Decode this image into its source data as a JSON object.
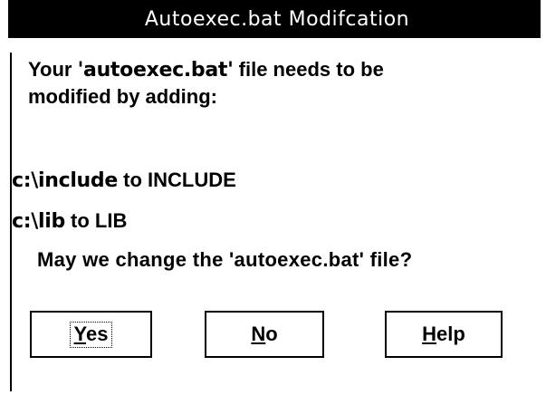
{
  "dialog": {
    "title": "Autoexec.bat Modifcation",
    "message": {
      "prefix": "Your ",
      "filename": "'autoexec.bat'",
      "suffix_line1": " file needs to be",
      "line2": "modified by adding:"
    },
    "entries": [
      {
        "path": "c:\\include",
        "text": " to INCLUDE"
      },
      {
        "path": "c:\\lib",
        "text": " to LIB"
      }
    ],
    "question": "May we change the 'autoexec.bat' file?",
    "buttons": {
      "yes": {
        "mnemonic": "Y",
        "rest": "es",
        "focused": true
      },
      "no": {
        "mnemonic": "N",
        "rest": "o"
      },
      "help": {
        "mnemonic": "H",
        "rest": "elp"
      }
    }
  }
}
